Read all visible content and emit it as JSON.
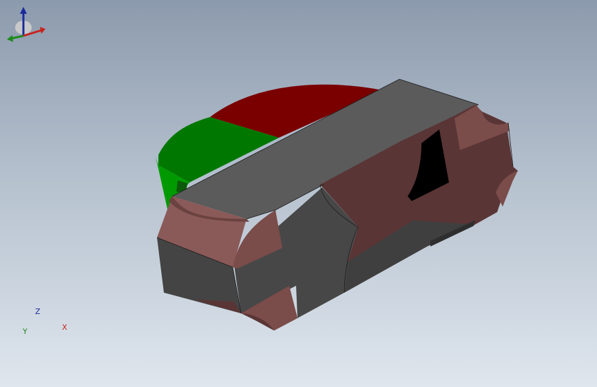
{
  "viewport": {
    "background_top": "#8c9aad",
    "background_bottom": "#dfe6ee"
  },
  "model": {
    "colors": {
      "red_face": "#7a0000",
      "green_face": "#007800",
      "green_side": "#009a00",
      "top_face": "#5b5b5b",
      "front_face": "#474747",
      "side_face": "#3f3f3f",
      "copper": "#5a3535",
      "copper_light": "#8a5a58",
      "opening": "#000000"
    }
  },
  "triad": {
    "z_label": "Z",
    "x_label": "X",
    "y_label": "Y",
    "z_color": "#1a2a9c",
    "x_color": "#c8221d",
    "y_color": "#1e8a1e"
  }
}
